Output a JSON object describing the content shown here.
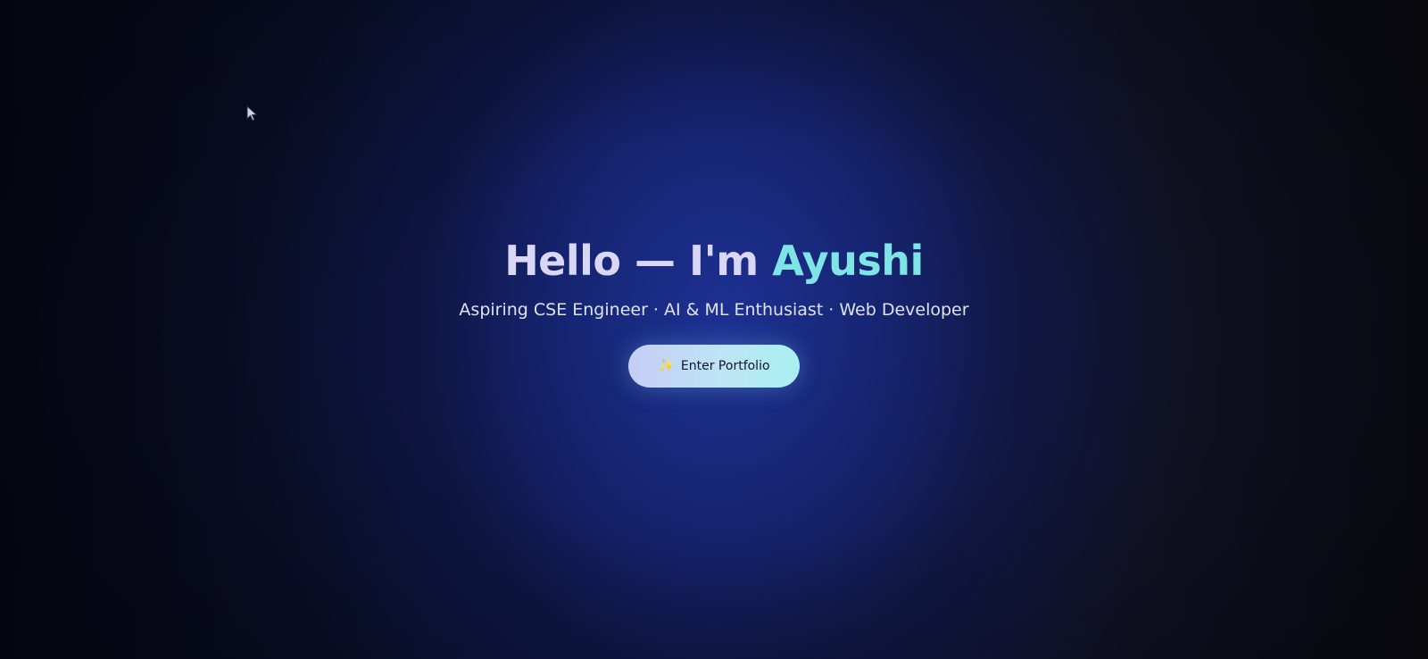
{
  "hero": {
    "greeting": "Hello — I'm",
    "name": "Ayushi",
    "subtitle": "Aspiring CSE Engineer · AI & ML Enthusiast · Web Developer",
    "button_label": "Enter Portfolio",
    "button_icon": "sparkles-icon"
  },
  "colors": {
    "background_center": "#1c2f8a",
    "background_edge": "#0a0b1a",
    "headline": "#d9d7f5",
    "name_accent": "#7ee4e6",
    "button_start": "#c6cdf5",
    "button_end": "#a9f0f0"
  }
}
